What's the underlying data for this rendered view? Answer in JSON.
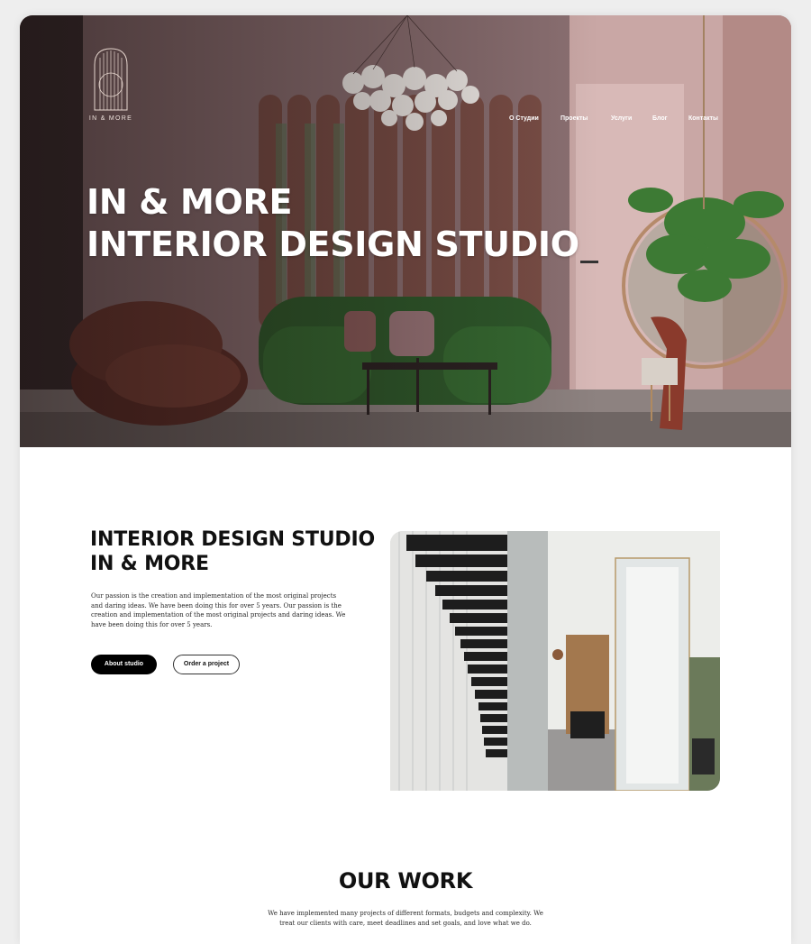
{
  "header": {
    "logo_text": "IN & MORE",
    "nav": [
      {
        "label": "О Студии"
      },
      {
        "label": "Проекты"
      },
      {
        "label": "Услуги"
      },
      {
        "label": "Блог"
      },
      {
        "label": "Контакты"
      }
    ]
  },
  "hero": {
    "title_line1": "IN & MORE",
    "title_line2": "INTERIOR DESIGN STUDIO"
  },
  "about": {
    "title_line1": "INTERIOR DESIGN STUDIO",
    "title_line2": "IN & MORE",
    "text": "Our passion is the creation and implementation of the most original projects and daring ideas. We have been doing this for over 5 years. Our passion is the creation and implementation of the most original projects and daring ideas. We have been doing this for over 5 years.",
    "primary_button": "About studio",
    "secondary_button": "Order a project"
  },
  "work": {
    "title": "OUR WORK",
    "text": "We have implemented many projects of different formats, budgets and complexity. We treat our clients with care, meet deadlines and set goals, and love what we do."
  },
  "colors": {
    "accent": "#000000",
    "hero_wall": "#8a6e70",
    "sofa_green": "#2f5a2c",
    "armchair_brown": "#6a3a30"
  }
}
